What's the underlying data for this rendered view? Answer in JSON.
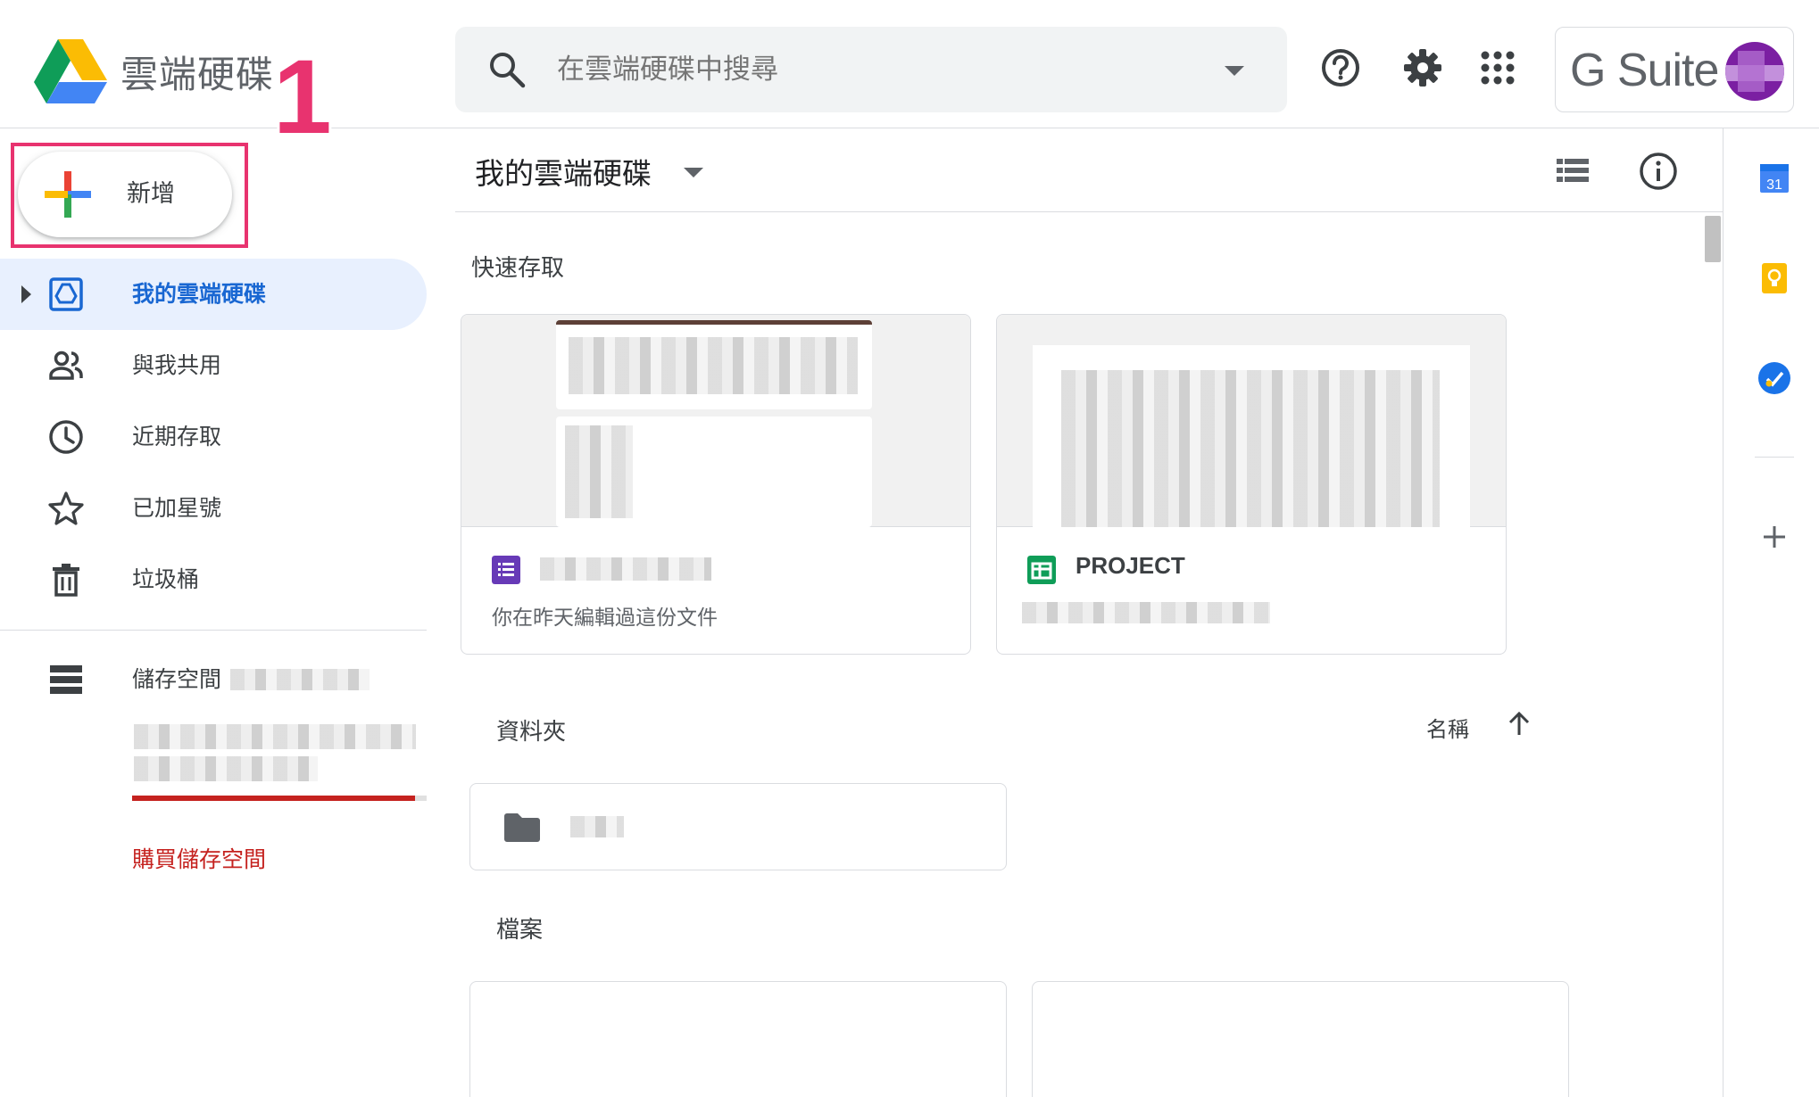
{
  "header": {
    "app_title": "雲端硬碟",
    "annotation_number": "1",
    "search": {
      "placeholder": "在雲端硬碟中搜尋"
    },
    "icons": [
      "help-icon",
      "settings-icon",
      "apps-grid-icon"
    ],
    "gsuite_label": "G Suite"
  },
  "sidebar": {
    "new_button_label": "新增",
    "items": [
      {
        "label": "我的雲端硬碟",
        "icon": "my-drive-icon",
        "active": true
      },
      {
        "label": "與我共用",
        "icon": "shared-people-icon",
        "active": false
      },
      {
        "label": "近期存取",
        "icon": "clock-icon",
        "active": false
      },
      {
        "label": "已加星號",
        "icon": "star-icon",
        "active": false
      },
      {
        "label": "垃圾桶",
        "icon": "trash-icon",
        "active": false
      }
    ],
    "storage": {
      "label": "儲存空間",
      "usage_fraction": 0.96,
      "buy_label": "購買儲存空間"
    }
  },
  "main": {
    "title": "我的雲端硬碟",
    "quick_access": {
      "heading": "快速存取",
      "cards": [
        {
          "name": "",
          "type": "forms",
          "subtitle": "你在昨天編輯過這份文件"
        },
        {
          "name": "PROJECT",
          "type": "sheets",
          "subtitle": ""
        }
      ]
    },
    "folders": {
      "heading": "資料夾",
      "sort_label": "名稱"
    },
    "files": {
      "heading": "檔案"
    }
  },
  "side_panel": {
    "calendar_day": "31",
    "icons": [
      "calendar-icon",
      "keep-icon",
      "tasks-icon",
      "add-icon"
    ]
  },
  "colors": {
    "accent_blue": "#1967d2",
    "active_bg": "#e8f0fe",
    "annotation_pink": "#e8336f",
    "storage_red": "#c5221f",
    "forms_purple": "#673ab7",
    "sheets_green": "#0f9d58"
  }
}
